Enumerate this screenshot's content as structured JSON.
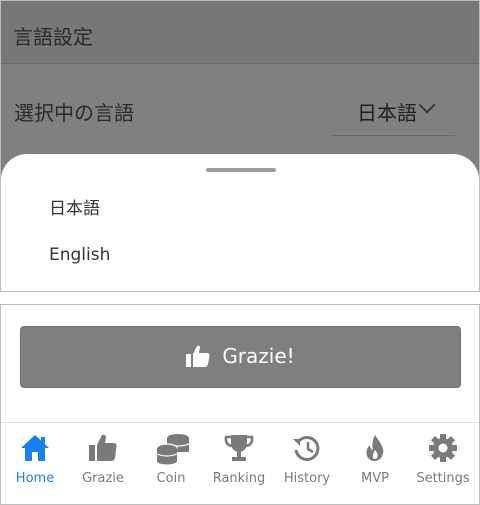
{
  "header": {
    "title": "言語設定"
  },
  "settings": {
    "language_row_label": "選択中の言語",
    "selected_language": "日本語"
  },
  "sheet": {
    "options": [
      "日本語",
      "English"
    ]
  },
  "action": {
    "grazie_button": "Grazie!"
  },
  "tabs": [
    {
      "label": "Home",
      "icon": "home-icon",
      "active": true
    },
    {
      "label": "Grazie",
      "icon": "thumbs-up-icon",
      "active": false
    },
    {
      "label": "Coin",
      "icon": "coins-icon",
      "active": false
    },
    {
      "label": "Ranking",
      "icon": "trophy-icon",
      "active": false
    },
    {
      "label": "History",
      "icon": "history-icon",
      "active": false
    },
    {
      "label": "MVP",
      "icon": "flame-icon",
      "active": false
    },
    {
      "label": "Settings",
      "icon": "gear-icon",
      "active": false
    }
  ],
  "colors": {
    "accent": "#1a7ff2",
    "overlay": "#808080",
    "button": "#7f7f7f"
  }
}
